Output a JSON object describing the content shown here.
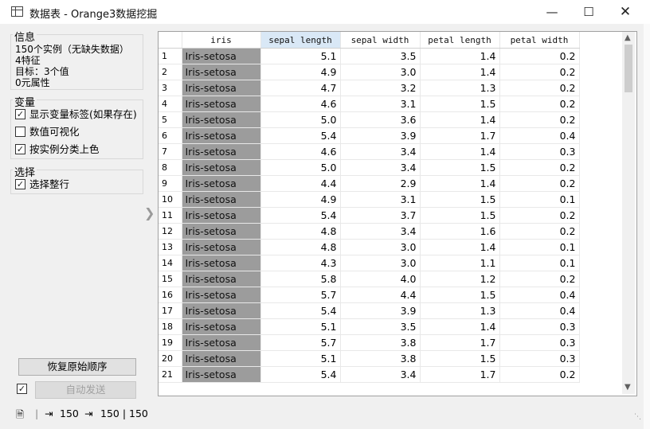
{
  "window": {
    "title": "数据表 - Orange3数据挖掘",
    "minimize": "—",
    "maximize": "☐",
    "close": "✕"
  },
  "info": {
    "title": "信息",
    "lines": [
      "150个实例（无缺失数据）",
      "4特征",
      "目标：3个值",
      "0元属性"
    ]
  },
  "variables": {
    "title": "变量",
    "options": [
      {
        "label": "显示变量标签(如果存在)",
        "checked": true
      },
      {
        "label": "数值可视化",
        "checked": false
      },
      {
        "label": "按实例分类上色",
        "checked": true
      }
    ]
  },
  "selection": {
    "title": "选择",
    "options": [
      {
        "label": "选择整行",
        "checked": true
      }
    ]
  },
  "buttons": {
    "restore": "恢复原始顺序",
    "autosend": "自动发送",
    "autosend_checked": true
  },
  "status": {
    "input_count": "150",
    "output_count": "150 | 150"
  },
  "table": {
    "columns": [
      "",
      "iris",
      "sepal length",
      "sepal width",
      "petal length",
      "petal width"
    ],
    "selected_column": "sepal length",
    "rows": [
      [
        "1",
        "Iris-setosa",
        "5.1",
        "3.5",
        "1.4",
        "0.2"
      ],
      [
        "2",
        "Iris-setosa",
        "4.9",
        "3.0",
        "1.4",
        "0.2"
      ],
      [
        "3",
        "Iris-setosa",
        "4.7",
        "3.2",
        "1.3",
        "0.2"
      ],
      [
        "4",
        "Iris-setosa",
        "4.6",
        "3.1",
        "1.5",
        "0.2"
      ],
      [
        "5",
        "Iris-setosa",
        "5.0",
        "3.6",
        "1.4",
        "0.2"
      ],
      [
        "6",
        "Iris-setosa",
        "5.4",
        "3.9",
        "1.7",
        "0.4"
      ],
      [
        "7",
        "Iris-setosa",
        "4.6",
        "3.4",
        "1.4",
        "0.3"
      ],
      [
        "8",
        "Iris-setosa",
        "5.0",
        "3.4",
        "1.5",
        "0.2"
      ],
      [
        "9",
        "Iris-setosa",
        "4.4",
        "2.9",
        "1.4",
        "0.2"
      ],
      [
        "10",
        "Iris-setosa",
        "4.9",
        "3.1",
        "1.5",
        "0.1"
      ],
      [
        "11",
        "Iris-setosa",
        "5.4",
        "3.7",
        "1.5",
        "0.2"
      ],
      [
        "12",
        "Iris-setosa",
        "4.8",
        "3.4",
        "1.6",
        "0.2"
      ],
      [
        "13",
        "Iris-setosa",
        "4.8",
        "3.0",
        "1.4",
        "0.1"
      ],
      [
        "14",
        "Iris-setosa",
        "4.3",
        "3.0",
        "1.1",
        "0.1"
      ],
      [
        "15",
        "Iris-setosa",
        "5.8",
        "4.0",
        "1.2",
        "0.2"
      ],
      [
        "16",
        "Iris-setosa",
        "5.7",
        "4.4",
        "1.5",
        "0.4"
      ],
      [
        "17",
        "Iris-setosa",
        "5.4",
        "3.9",
        "1.3",
        "0.4"
      ],
      [
        "18",
        "Iris-setosa",
        "5.1",
        "3.5",
        "1.4",
        "0.3"
      ],
      [
        "19",
        "Iris-setosa",
        "5.7",
        "3.8",
        "1.7",
        "0.3"
      ],
      [
        "20",
        "Iris-setosa",
        "5.1",
        "3.8",
        "1.5",
        "0.3"
      ],
      [
        "21",
        "Iris-setosa",
        "5.4",
        "3.4",
        "1.7",
        "0.2"
      ]
    ]
  },
  "colors": {
    "class_cell": "#9c9c9c",
    "selected_header": "#d9e8f6"
  }
}
